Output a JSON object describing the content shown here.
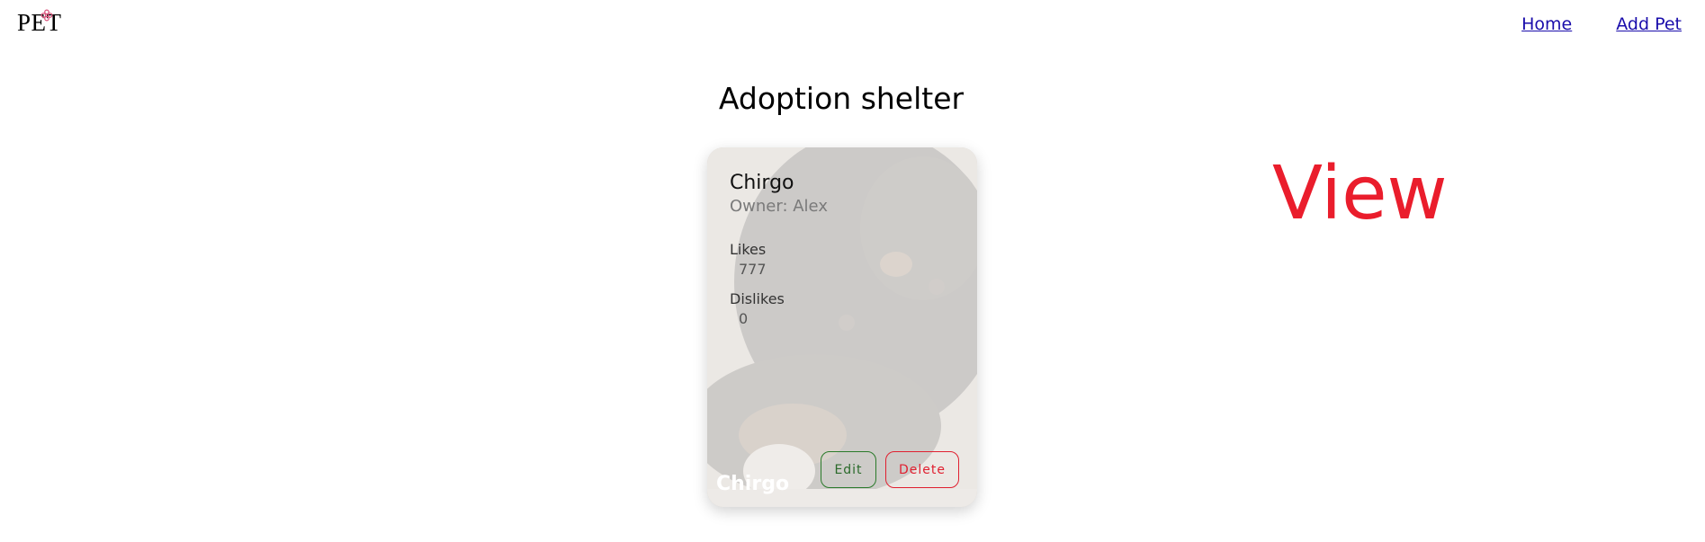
{
  "header": {
    "logo_text": "PET",
    "nav": [
      {
        "label": "Home"
      },
      {
        "label": "Add Pet"
      }
    ]
  },
  "page": {
    "title": "Adoption shelter"
  },
  "pet_card": {
    "name": "Chirgo",
    "owner": "Owner: Alex",
    "likes_label": "Likes",
    "likes_value": "777",
    "dislikes_label": "Dislikes",
    "dislikes_value": "0",
    "caption": "Chirgo",
    "edit_label": "Edit",
    "delete_label": "Delete"
  },
  "annotation": {
    "text": "View"
  },
  "colors": {
    "link": "#1a0dab",
    "edit": "#2a7a2a",
    "delete": "#e02030",
    "annotation": "#ea1d2c"
  }
}
